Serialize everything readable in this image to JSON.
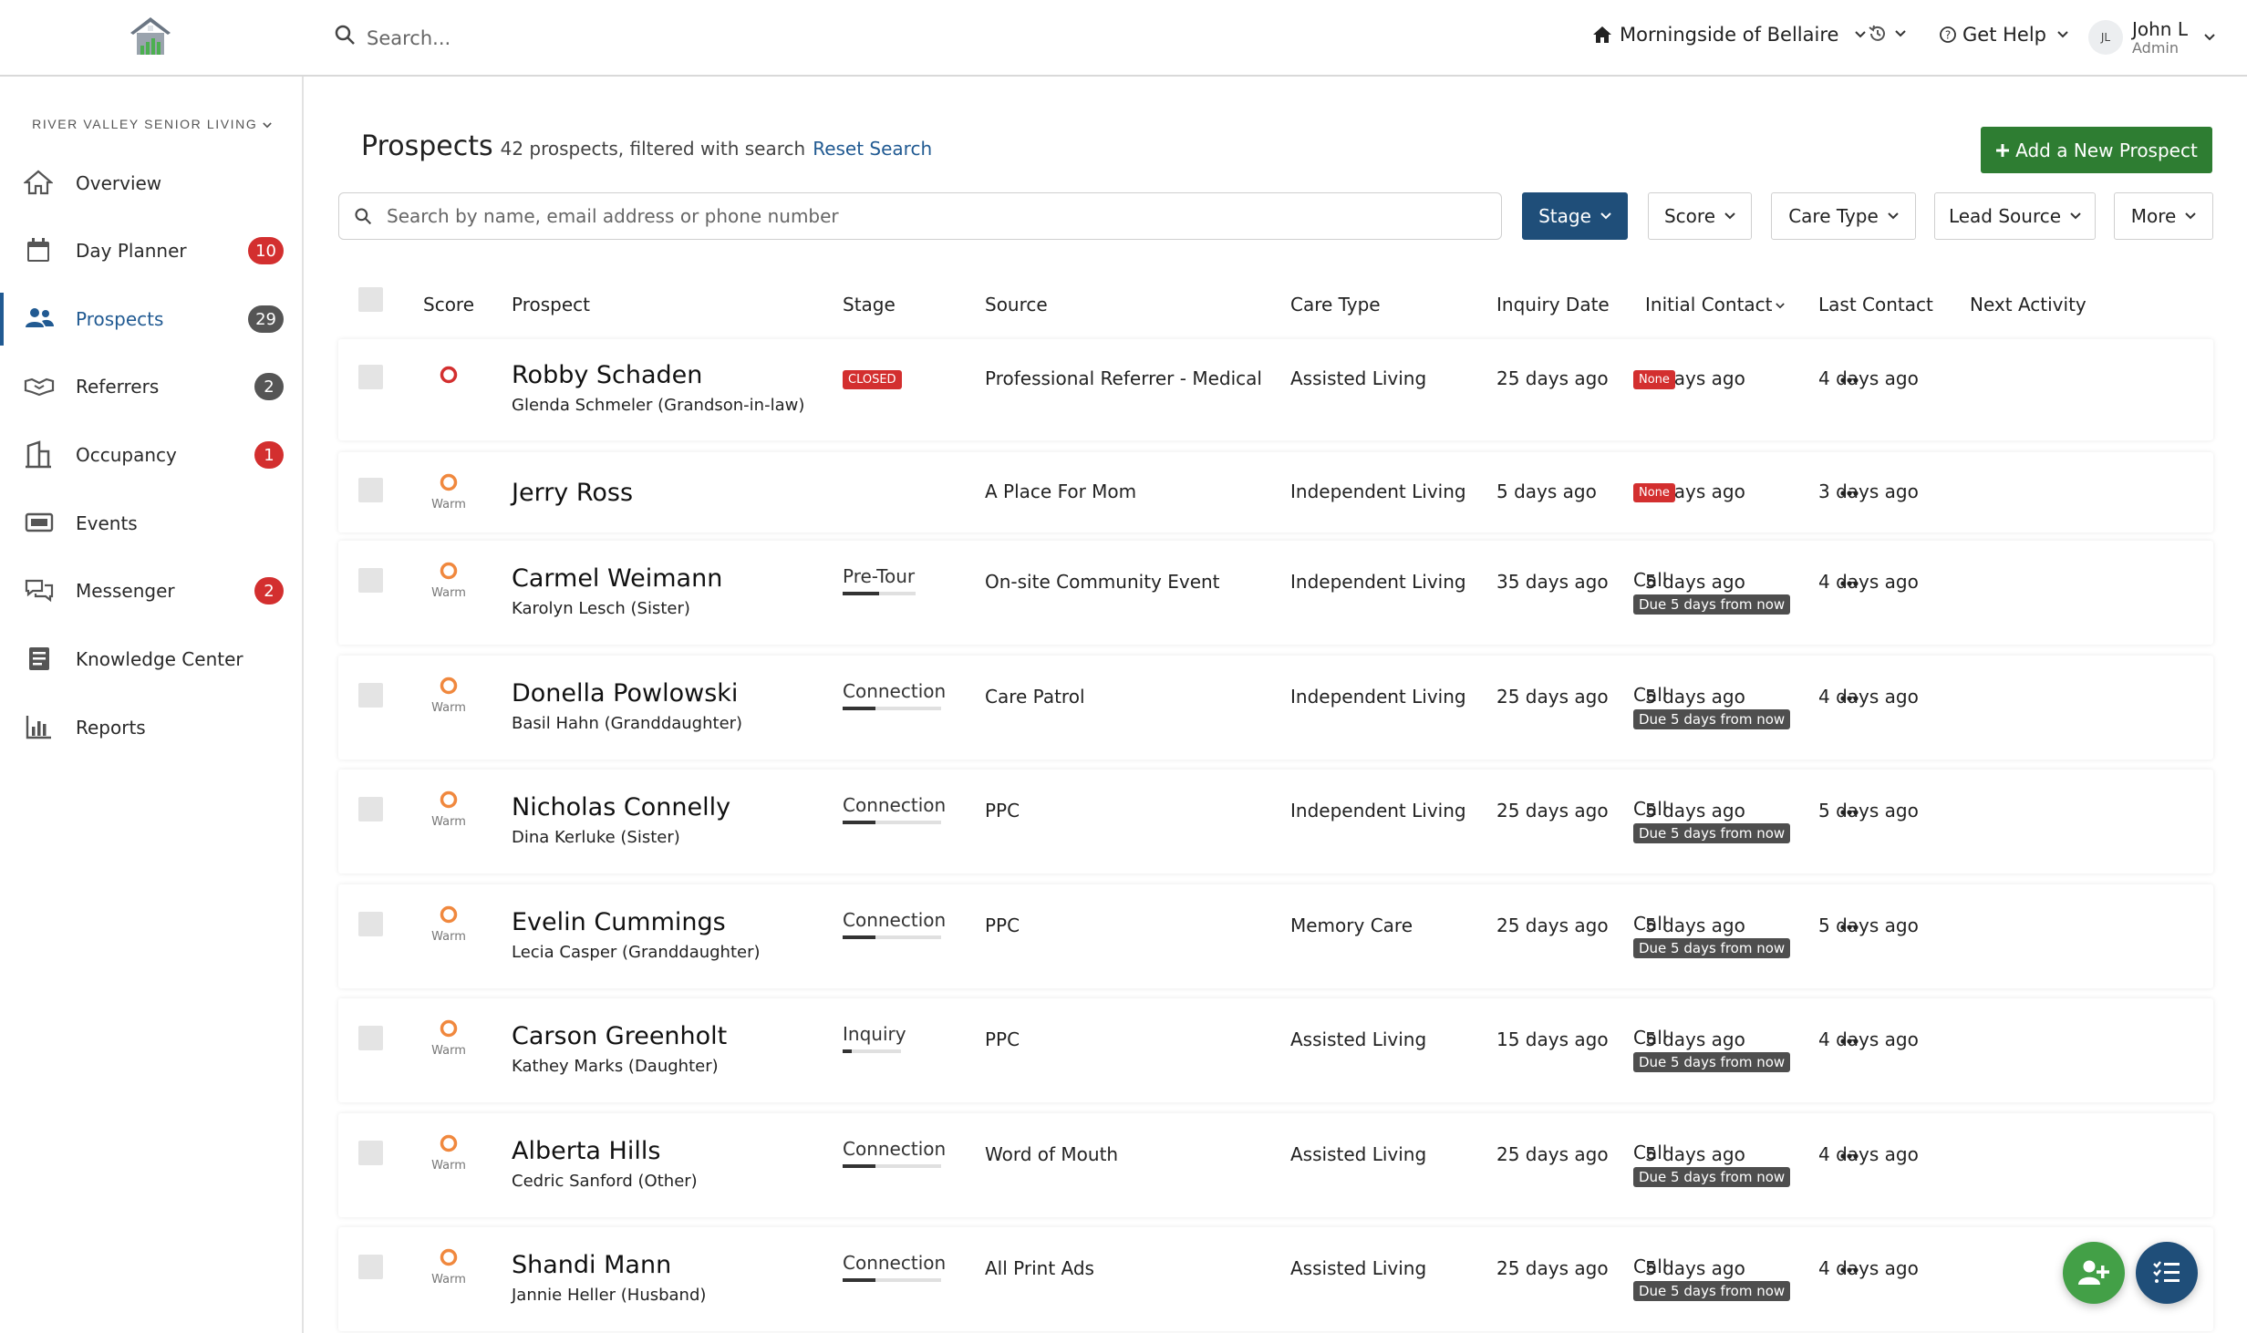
{
  "app": {
    "search_placeholder": "Search...",
    "community": "Morningside of Bellaire",
    "help": "Get Help",
    "user": {
      "initials": "JL",
      "name": "John L",
      "role": "Admin"
    }
  },
  "sidebar": {
    "org": "RIVER VALLEY SENIOR LIVING",
    "items": [
      {
        "label": "Overview",
        "icon": "home-icon"
      },
      {
        "label": "Day Planner",
        "icon": "calendar-icon",
        "badge": "10"
      },
      {
        "label": "Prospects",
        "icon": "users-icon",
        "badge": "29"
      },
      {
        "label": "Referrers",
        "icon": "handshake-icon",
        "badge": "2"
      },
      {
        "label": "Occupancy",
        "icon": "building-icon",
        "badge": "1"
      },
      {
        "label": "Events",
        "icon": "ticket-icon"
      },
      {
        "label": "Messenger",
        "icon": "chat-icon",
        "badge": "2"
      },
      {
        "label": "Knowledge Center",
        "icon": "book-icon"
      },
      {
        "label": "Reports",
        "icon": "bar-chart-icon"
      }
    ]
  },
  "main": {
    "title": "Prospects",
    "count_text": "42 prospects, filtered with search",
    "reset_label": "Reset Search",
    "add_label": "Add a New Prospect",
    "search_placeholder": "Search by name, email address or phone number",
    "filters": [
      "Stage",
      "Score",
      "Care Type",
      "Lead Source",
      "More"
    ],
    "columns": [
      "Score",
      "Prospect",
      "Stage",
      "Source",
      "Care Type",
      "Inquiry Date",
      "Initial Contact",
      "Last Contact",
      "Next Activity"
    ]
  },
  "colors": {
    "accent": "#215a92",
    "add_button": "#2e7d32",
    "badge_red": "#d32f2f",
    "badge_gray": "#555555",
    "score_hot": "#d32f2f",
    "score_warm": "#f0883e"
  },
  "rows": [
    {
      "score": "hot",
      "score_label": "",
      "name": "Robby Schaden",
      "contact": "Glenda Schmeler (Grandson-in-law)",
      "stage": "CLOSED",
      "stage_progress": null,
      "source": "Professional Referrer - Medical",
      "care_type": "Assisted Living",
      "inquiry": "25 days ago",
      "initial": "4 days ago",
      "last": "4 days ago",
      "activity": "None",
      "due": ""
    },
    {
      "score": "warm",
      "score_label": "Warm",
      "name": "Jerry Ross",
      "contact": "",
      "stage": "",
      "stage_progress": null,
      "source": "A Place For Mom",
      "care_type": "Independent Living",
      "inquiry": "5 days ago",
      "initial": "4 days ago",
      "last": "3 days ago",
      "activity": "None",
      "due": ""
    },
    {
      "score": "warm",
      "score_label": "Warm",
      "name": "Carmel Weimann",
      "contact": "Karolyn Lesch (Sister)",
      "stage": "Pre-Tour",
      "stage_progress": 0.5,
      "source": "On-site Community Event",
      "care_type": "Independent Living",
      "inquiry": "35 days ago",
      "initial": "5 days ago",
      "last": "4 days ago",
      "activity": "Call",
      "due": "Due 5 days from now"
    },
    {
      "score": "warm",
      "score_label": "Warm",
      "name": "Donella Powlowski",
      "contact": "Basil Hahn (Granddaughter)",
      "stage": "Connection",
      "stage_progress": 0.33,
      "source": "Care Patrol",
      "care_type": "Independent Living",
      "inquiry": "25 days ago",
      "initial": "5 days ago",
      "last": "4 days ago",
      "activity": "Call",
      "due": "Due 5 days from now"
    },
    {
      "score": "warm",
      "score_label": "Warm",
      "name": "Nicholas Connelly",
      "contact": "Dina Kerluke (Sister)",
      "stage": "Connection",
      "stage_progress": 0.33,
      "source": "PPC",
      "care_type": "Independent Living",
      "inquiry": "25 days ago",
      "initial": "5 days ago",
      "last": "5 days ago",
      "activity": "Call",
      "due": "Due 5 days from now"
    },
    {
      "score": "warm",
      "score_label": "Warm",
      "name": "Evelin Cummings",
      "contact": "Lecia Casper (Granddaughter)",
      "stage": "Connection",
      "stage_progress": 0.33,
      "source": "PPC",
      "care_type": "Memory Care",
      "inquiry": "25 days ago",
      "initial": "5 days ago",
      "last": "5 days ago",
      "activity": "Call",
      "due": "Due 5 days from now"
    },
    {
      "score": "warm",
      "score_label": "Warm",
      "name": "Carson Greenholt",
      "contact": "Kathey Marks (Daughter)",
      "stage": "Inquiry",
      "stage_progress": 0.15,
      "source": "PPC",
      "care_type": "Assisted Living",
      "inquiry": "15 days ago",
      "initial": "5 days ago",
      "last": "4 days ago",
      "activity": "Call",
      "due": "Due 5 days from now"
    },
    {
      "score": "warm",
      "score_label": "Warm",
      "name": "Alberta Hills",
      "contact": "Cedric Sanford (Other)",
      "stage": "Connection",
      "stage_progress": 0.33,
      "source": "Word of Mouth",
      "care_type": "Assisted Living",
      "inquiry": "25 days ago",
      "initial": "5 days ago",
      "last": "4 days ago",
      "activity": "Call",
      "due": "Due 5 days from now"
    },
    {
      "score": "warm",
      "score_label": "Warm",
      "name": "Shandi Mann",
      "contact": "Jannie Heller (Husband)",
      "stage": "Connection",
      "stage_progress": 0.33,
      "source": "All Print Ads",
      "care_type": "Assisted Living",
      "inquiry": "25 days ago",
      "initial": "5 days ago",
      "last": "4 days ago",
      "activity": "Call",
      "due": "Due 5 days from now"
    }
  ]
}
